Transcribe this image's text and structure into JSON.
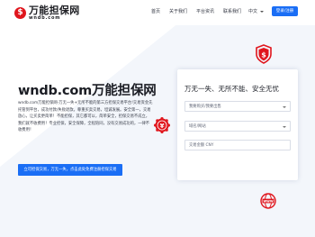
{
  "brand": {
    "title": "万能担保网",
    "domain": "wndb.com"
  },
  "nav": {
    "items": [
      {
        "label": "首页"
      },
      {
        "label": "关于我们"
      },
      {
        "label": "平台资讯"
      },
      {
        "label": "联系我们"
      }
    ],
    "language": "中文",
    "login_label": "登录/注册"
  },
  "hero": {
    "title": "wndb.com万能担保网",
    "description": "wndb.com万能担保网-万无一失+无所不能的第三方担保交易平台!交易资金先托管到平台，成功付款/失败退款。尊重买卖交易，坦诚发展。安全第一，交易放心，让买卖更简单！不能担保，其它都可以，简单安全，担保交易不成立，我们就不收费用！专业担保，安全保障，全程陪同，没有交易成功的，一律不收费用！",
    "cta_label": "立可担保交易，万无一失，点击此处免费注册担保交易"
  },
  "form": {
    "title": "万无一失、无所不能、安全无忧",
    "fields": [
      {
        "label": "我要购买/我要出售",
        "type": "select"
      },
      {
        "label": "域名/网站",
        "type": "select"
      },
      {
        "label": "交易金额 CNY",
        "type": "input"
      }
    ]
  },
  "colors": {
    "accent": "#1a6ef5",
    "brand_red": "#e0161d",
    "stripe": "#f3f6fb"
  },
  "icons": [
    "dollar-seal-icon",
    "yuan-seal-icon",
    "globe-seal-icon"
  ]
}
